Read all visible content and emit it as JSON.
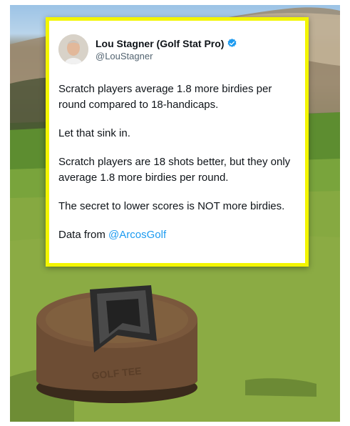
{
  "tweet": {
    "author_name": "Lou Stagner (Golf Stat Pro)",
    "handle": "@LouStagner",
    "verified_icon": "verified-badge-icon",
    "paragraphs": [
      "Scratch players average 1.8 more birdies per round compared to 18-handicaps.",
      "Let that sink in.",
      "Scratch players are 18 shots better, but they only average 1.8 more birdies per round.",
      "The secret to lower scores is NOT more birdies."
    ],
    "source_prefix": "Data from ",
    "source_mention": "@ArcosGolf"
  },
  "tee_marker_text": "GOLF TEE",
  "colors": {
    "card_border": "#f3f500",
    "mention": "#1d9bf0",
    "verified": "#1d9bf0",
    "text": "#0f1419",
    "handle": "#536471"
  }
}
